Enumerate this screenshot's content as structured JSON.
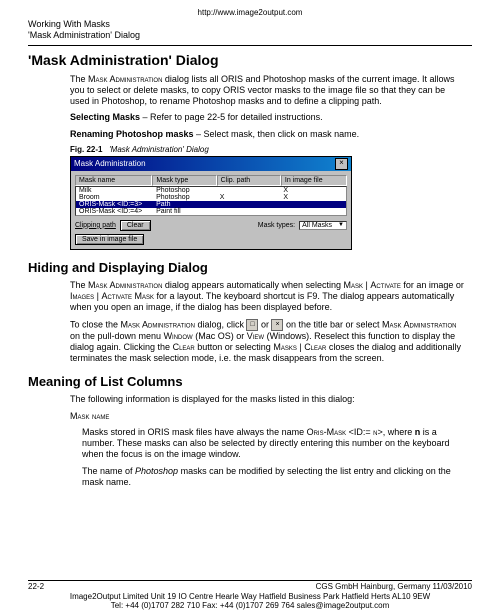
{
  "url": "http://www.image2output.com",
  "header": {
    "line1": "Working With Masks",
    "line2": "'Mask Administration' Dialog"
  },
  "h1": "'Mask Administration' Dialog",
  "intro": {
    "p1a": "The ",
    "p1b": "Mask Administration",
    "p1c": " dialog lists all ORIS and Photoshop masks of the current image. It allows you to select or delete masks, to copy ORIS vector masks to the image file so that they can be used in Photoshop, to rename Photoshop masks and to define a clipping path.",
    "p2a": "Selecting Masks",
    "p2b": " – Refer to page 22-5 for detailed instructions.",
    "p3a": "Renaming Photoshop masks",
    "p3b": " – Select mask, then click on mask name."
  },
  "figcaption": {
    "num": "Fig. 22-1",
    "text": "'Mask Administration' Dialog"
  },
  "dialog": {
    "title": "Mask Administration",
    "cols": {
      "name": "Mask name",
      "type": "Mask type",
      "clip": "Clip. path",
      "img": "In image file"
    },
    "rows": [
      {
        "name": "Milk",
        "type": "Photoshop",
        "clip": "",
        "img": "X"
      },
      {
        "name": "Broom",
        "type": "Photoshop",
        "clip": "X",
        "img": "X"
      },
      {
        "name": "ORIS-Mask <ID:=3>",
        "type": "Path",
        "clip": "",
        "img": "",
        "selected": true
      },
      {
        "name": "ORIS-Mask <ID:=4>",
        "type": "Paint fill",
        "clip": "",
        "img": ""
      }
    ],
    "clippingPathLabel": "Clipping path",
    "clearBtn": "Clear",
    "maskTypesLabel": "Mask types:",
    "maskTypesValue": "All Masks",
    "saveBtn": "Save in image file"
  },
  "h2a": "Hiding and Displaying Dialog",
  "hide": {
    "p1a": "The ",
    "p1b": "Mask Administration",
    "p1c": " dialog appears automatically when selecting ",
    "p1d": "Mask",
    "p1e": " | ",
    "p1f": "Activate",
    "p1g": " for an image or ",
    "p1h": "Images",
    "p1i": " | ",
    "p1j": "Activate Mask",
    "p1k": " for a layout. The keyboard shortcut is F9. The dialog appears automatically when you open an image, if the dialog has been displayed before.",
    "p2a": "To close the ",
    "p2b": "Mask Administration",
    "p2c": " dialog, click ",
    "p2d": " or ",
    "p2e": " on the title bar or select ",
    "p2f": "Mask Administration",
    "p2g": " on the pull-down menu ",
    "p2h": "Window",
    "p2i": " (Mac OS) or ",
    "p2j": "View",
    "p2k": " (Windows). Reselect this function to display the dialog again. Clicking the ",
    "p2l": "Clear",
    "p2m": " button or selecting ",
    "p2n": "Masks",
    "p2o": " | ",
    "p2p": "Clear",
    "p2q": " closes the dialog and additionally terminates the mask selection mode, i.e. the mask disappears from the screen."
  },
  "h2b": "Meaning of List Columns",
  "meaning": {
    "intro": "The following information is displayed for the masks listed in this dialog:",
    "maskNameLabel": "Mask name",
    "p1a": "Masks stored in ORIS mask files have always the name ",
    "p1b": "Oris-Mask",
    "p1c": " <",
    "p1d": "ID:= n",
    "p1e": ">, where ",
    "p1f": "n",
    "p1g": " is a number. These masks can also be selected by directly entering this number on the keyboard when the focus is on the image window.",
    "p2a": "The name of ",
    "p2b": "Photoshop",
    "p2c": " masks can be modified by selecting the list entry and clicking on the mask name."
  },
  "footer": {
    "pagenum": "22-2",
    "center": "CGS GmbH   Hainburg, Germany   11/03/2010",
    "line2": "Image2Output Limited  Unit 19 IO Centre Hearle Way Hatfield Business Park Hatfield Herts AL10 9EW",
    "line3": "Tel: +44 (0)1707 282 710 Fax: +44 (0)1707 269 764 sales@image2output.com"
  }
}
